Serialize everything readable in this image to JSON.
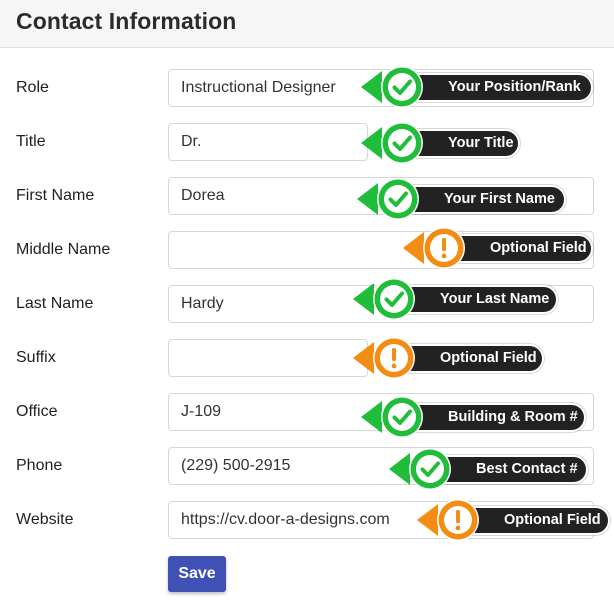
{
  "header": {
    "title": "Contact Information"
  },
  "fields": [
    {
      "label": "Role",
      "value": "Instructional Designer",
      "placeholder": ""
    },
    {
      "label": "Title",
      "value": "Dr.",
      "placeholder": ""
    },
    {
      "label": "First Name",
      "value": "Dorea",
      "placeholder": ""
    },
    {
      "label": "Middle Name",
      "value": "",
      "placeholder": ""
    },
    {
      "label": "Last Name",
      "value": "Hardy",
      "placeholder": ""
    },
    {
      "label": "Suffix",
      "value": "",
      "placeholder": ""
    },
    {
      "label": "Office",
      "value": "J-109",
      "placeholder": ""
    },
    {
      "label": "Phone",
      "value": "(229) 500-2915",
      "placeholder": ""
    },
    {
      "label": "Website",
      "value": "https://cv.door-a-designs.com",
      "placeholder": ""
    }
  ],
  "callouts": [
    {
      "text": "Your Position/Rank",
      "status": "required",
      "icon": "check-icon"
    },
    {
      "text": "Your Title",
      "status": "required",
      "icon": "check-icon"
    },
    {
      "text": "Your First Name",
      "status": "required",
      "icon": "check-icon"
    },
    {
      "text": "Optional Field",
      "status": "optional",
      "icon": "exclamation-icon"
    },
    {
      "text": "Your Last Name",
      "status": "required",
      "icon": "check-icon"
    },
    {
      "text": "Optional Field",
      "status": "optional",
      "icon": "exclamation-icon"
    },
    {
      "text": "Building & Room #",
      "status": "required",
      "icon": "check-icon"
    },
    {
      "text": "Best Contact #",
      "status": "required",
      "icon": "check-icon"
    },
    {
      "text": "Optional Field",
      "status": "optional",
      "icon": "exclamation-icon"
    }
  ],
  "colors": {
    "required": "#1fbd3a",
    "optional": "#f28c13",
    "pill": "#222222",
    "save_button": "#3f51b5"
  },
  "save_label": "Save"
}
